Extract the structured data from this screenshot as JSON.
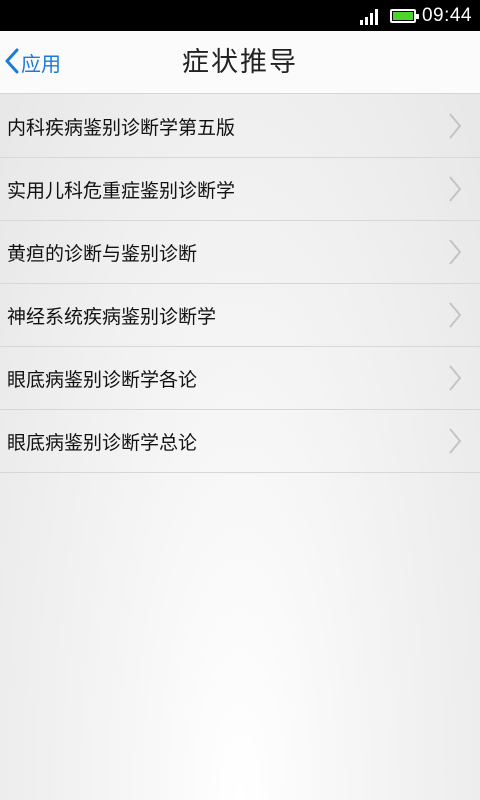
{
  "status_bar": {
    "time": "09:44"
  },
  "nav": {
    "back_label": "应用",
    "title": "症状推导"
  },
  "list": {
    "items": [
      {
        "label": "内科疾病鉴别诊断学第五版"
      },
      {
        "label": "实用儿科危重症鉴别诊断学"
      },
      {
        "label": "黄疸的诊断与鉴别诊断"
      },
      {
        "label": "神经系统疾病鉴别诊断学"
      },
      {
        "label": "眼底病鉴别诊断学各论"
      },
      {
        "label": "眼底病鉴别诊断学总论"
      }
    ]
  },
  "colors": {
    "accent": "#1a7bd8",
    "battery": "#4cd52d"
  }
}
